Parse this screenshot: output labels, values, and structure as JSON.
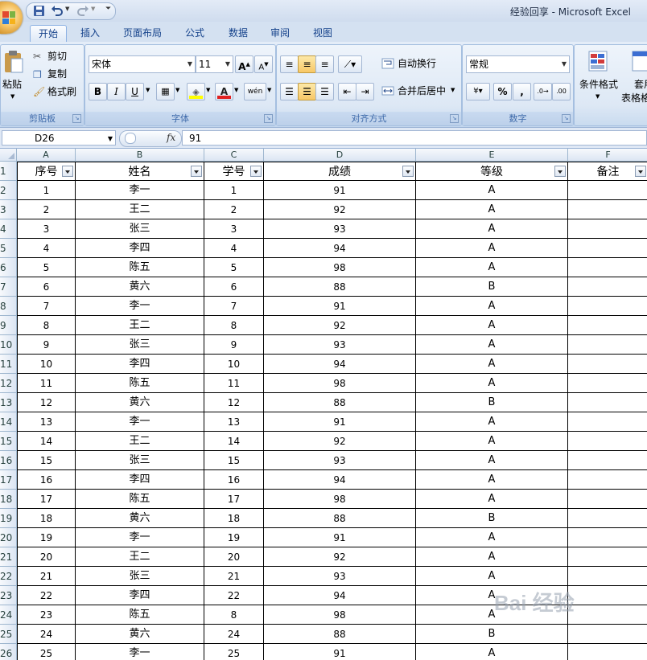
{
  "window": {
    "title": "经验回享 - Microsoft Excel"
  },
  "quick_access": {
    "save_icon": "save-icon",
    "undo_icon": "undo-icon",
    "redo_icon": "redo-icon"
  },
  "tabs": [
    {
      "label": "开始",
      "active": true
    },
    {
      "label": "插入"
    },
    {
      "label": "页面布局"
    },
    {
      "label": "公式"
    },
    {
      "label": "数据"
    },
    {
      "label": "审阅"
    },
    {
      "label": "视图"
    }
  ],
  "ribbon": {
    "clipboard": {
      "label": "剪贴板",
      "paste": "粘贴",
      "cut": "剪切",
      "copy": "复制",
      "format_painter": "格式刷"
    },
    "font": {
      "label": "字体",
      "font_name": "宋体",
      "font_size": "11",
      "bold": "B",
      "italic": "I",
      "underline": "U",
      "grow": "A",
      "shrink": "A"
    },
    "alignment": {
      "label": "对齐方式",
      "wrap_text": "自动换行",
      "merge_center": "合并后居中"
    },
    "number": {
      "label": "数字",
      "format": "常规",
      "percent": "%",
      "comma": ","
    },
    "styles": {
      "conditional": "条件格式",
      "table_format_1": "套用",
      "table_format_2": "表格格"
    }
  },
  "formula_bar": {
    "name_box": "D26",
    "fx": "fx",
    "value": "91"
  },
  "sheet": {
    "columns": [
      "A",
      "B",
      "C",
      "D",
      "E",
      "F"
    ],
    "header": [
      "序号",
      "姓名",
      "学号",
      "成绩",
      "等级",
      "备注"
    ],
    "rows": [
      [
        "1",
        "李一",
        "1",
        "91",
        "A",
        ""
      ],
      [
        "2",
        "王二",
        "2",
        "92",
        "A",
        ""
      ],
      [
        "3",
        "张三",
        "3",
        "93",
        "A",
        ""
      ],
      [
        "4",
        "李四",
        "4",
        "94",
        "A",
        ""
      ],
      [
        "5",
        "陈五",
        "5",
        "98",
        "A",
        ""
      ],
      [
        "6",
        "黄六",
        "6",
        "88",
        "B",
        ""
      ],
      [
        "7",
        "李一",
        "7",
        "91",
        "A",
        ""
      ],
      [
        "8",
        "王二",
        "8",
        "92",
        "A",
        ""
      ],
      [
        "9",
        "张三",
        "9",
        "93",
        "A",
        ""
      ],
      [
        "10",
        "李四",
        "10",
        "94",
        "A",
        ""
      ],
      [
        "11",
        "陈五",
        "11",
        "98",
        "A",
        ""
      ],
      [
        "12",
        "黄六",
        "12",
        "88",
        "B",
        ""
      ],
      [
        "13",
        "李一",
        "13",
        "91",
        "A",
        ""
      ],
      [
        "14",
        "王二",
        "14",
        "92",
        "A",
        ""
      ],
      [
        "15",
        "张三",
        "15",
        "93",
        "A",
        ""
      ],
      [
        "16",
        "李四",
        "16",
        "94",
        "A",
        ""
      ],
      [
        "17",
        "陈五",
        "17",
        "98",
        "A",
        ""
      ],
      [
        "18",
        "黄六",
        "18",
        "88",
        "B",
        ""
      ],
      [
        "19",
        "李一",
        "19",
        "91",
        "A",
        ""
      ],
      [
        "20",
        "王二",
        "20",
        "92",
        "A",
        ""
      ],
      [
        "21",
        "张三",
        "21",
        "93",
        "A",
        ""
      ],
      [
        "22",
        "李四",
        "22",
        "94",
        "A",
        ""
      ],
      [
        "23",
        "陈五",
        "8",
        "98",
        "A",
        ""
      ],
      [
        "24",
        "黄六",
        "24",
        "88",
        "B",
        ""
      ],
      [
        "25",
        "李一",
        "25",
        "91",
        "A",
        ""
      ]
    ]
  },
  "watermark": "Bai 经验"
}
